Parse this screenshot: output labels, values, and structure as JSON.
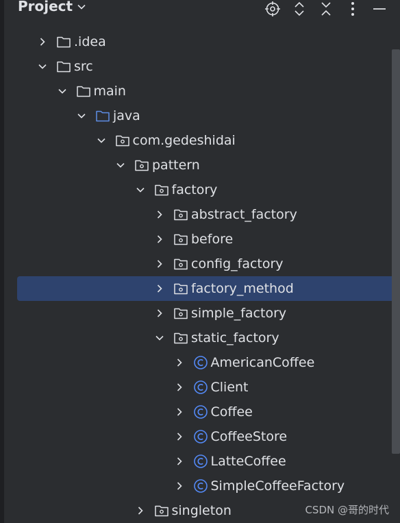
{
  "panel": {
    "title": "Project",
    "icons": [
      "locate-icon",
      "expand-all-icon",
      "collapse-all-icon",
      "more-options-icon",
      "minimize-icon"
    ]
  },
  "tree": [
    {
      "label": ".idea",
      "depth": 0,
      "expanded": false,
      "icon": "folder"
    },
    {
      "label": "src",
      "depth": 0,
      "expanded": true,
      "icon": "folder"
    },
    {
      "label": "main",
      "depth": 1,
      "expanded": true,
      "icon": "folder"
    },
    {
      "label": "java",
      "depth": 2,
      "expanded": true,
      "icon": "source-folder"
    },
    {
      "label": "com.gedeshidai",
      "depth": 3,
      "expanded": true,
      "icon": "package"
    },
    {
      "label": "pattern",
      "depth": 4,
      "expanded": true,
      "icon": "package"
    },
    {
      "label": "factory",
      "depth": 5,
      "expanded": true,
      "icon": "package"
    },
    {
      "label": "abstract_factory",
      "depth": 6,
      "expanded": false,
      "icon": "package"
    },
    {
      "label": "before",
      "depth": 6,
      "expanded": false,
      "icon": "package"
    },
    {
      "label": "config_factory",
      "depth": 6,
      "expanded": false,
      "icon": "package"
    },
    {
      "label": "factory_method",
      "depth": 6,
      "expanded": false,
      "icon": "package",
      "selected": true
    },
    {
      "label": "simple_factory",
      "depth": 6,
      "expanded": false,
      "icon": "package"
    },
    {
      "label": "static_factory",
      "depth": 6,
      "expanded": true,
      "icon": "package"
    },
    {
      "label": "AmericanCoffee",
      "depth": 7,
      "expanded": false,
      "icon": "class"
    },
    {
      "label": "Client",
      "depth": 7,
      "expanded": false,
      "icon": "class"
    },
    {
      "label": "Coffee",
      "depth": 7,
      "expanded": false,
      "icon": "class"
    },
    {
      "label": "CoffeeStore",
      "depth": 7,
      "expanded": false,
      "icon": "class"
    },
    {
      "label": "LatteCoffee",
      "depth": 7,
      "expanded": false,
      "icon": "class"
    },
    {
      "label": "SimpleCoffeeFactory",
      "depth": 7,
      "expanded": false,
      "icon": "class"
    },
    {
      "label": "singleton",
      "depth": 5,
      "expanded": false,
      "icon": "package"
    }
  ],
  "watermark": "CSDN @哥的时代",
  "colors": {
    "background": "#2b2d30",
    "selection": "#2e436e",
    "text": "#dfe1e5",
    "source_folder": "#5e8ee6",
    "class_icon": "#548af7"
  }
}
